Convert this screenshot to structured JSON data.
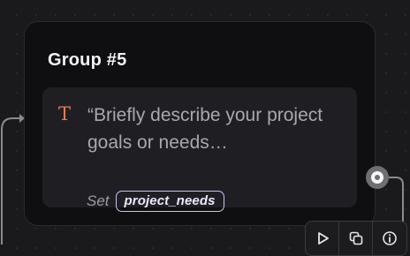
{
  "group": {
    "title": "Group #5",
    "block": {
      "icon": "text-icon",
      "icon_glyph": "T",
      "prompt": "“Briefly describe your project goals or needs…",
      "set_label": "Set",
      "variable": "project_needs"
    }
  },
  "toolbar": {
    "buttons": [
      {
        "icon": "play-icon"
      },
      {
        "icon": "duplicate-icon"
      },
      {
        "icon": "info-icon"
      }
    ]
  },
  "colors": {
    "canvas": "#1a1a1d",
    "card": "#0f0f11",
    "block": "#1f1f23",
    "accent_text_icon": "#ea7a4f",
    "variable_border": "#c9c2f3"
  }
}
